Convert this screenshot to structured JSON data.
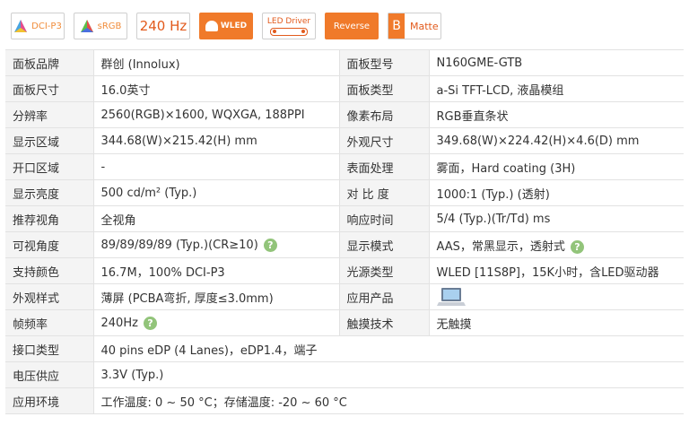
{
  "badges": {
    "dci": "DCI-P3",
    "srgb": "sRGB",
    "hz": "240 Hz",
    "wled": "WLED",
    "driver": "LED Driver",
    "reverse": "Reverse",
    "matte_letter": "B",
    "matte": "Matte"
  },
  "rows": [
    {
      "l1": "面板品牌",
      "v1": "群创 (Innolux)",
      "l2": "面板型号",
      "v2": "N160GME-GTB"
    },
    {
      "l1": "面板尺寸",
      "v1": "16.0英寸",
      "l2": "面板类型",
      "v2": "a-Si TFT-LCD, 液晶模组"
    },
    {
      "l1": "分辨率",
      "v1": "2560(RGB)×1600, WQXGA, 188PPI",
      "l2": "像素布局",
      "v2": "RGB垂直条状"
    },
    {
      "l1": "显示区域",
      "v1": "344.68(W)×215.42(H) mm",
      "l2": "外观尺寸",
      "v2": "349.68(W)×224.42(H)×4.6(D) mm"
    },
    {
      "l1": "开口区域",
      "v1": "-",
      "l2": "表面处理",
      "v2": "雾面，Hard coating (3H)"
    },
    {
      "l1": "显示亮度",
      "v1": "500 cd/m² (Typ.)",
      "l2": "对 比 度",
      "v2": "1000:1 (Typ.) (透射)"
    },
    {
      "l1": "推荐视角",
      "v1": "全视角",
      "l2": "响应时间",
      "v2": "5/4 (Typ.)(Tr/Td) ms"
    },
    {
      "l1": "可视角度",
      "v1": "89/89/89/89 (Typ.)(CR≥10)",
      "l2": "显示模式",
      "v2": "AAS，常黑显示，透射式"
    },
    {
      "l1": "支持颜色",
      "v1": "16.7M，100% DCI-P3",
      "l2": "光源类型",
      "v2": "WLED  [11S8P]，15K小时，含LED驱动器"
    },
    {
      "l1": "外观样式",
      "v1": "薄屏 (PCBA弯折, 厚度≤3.0mm)",
      "l2": "应用产品",
      "v2": ""
    },
    {
      "l1": "帧频率",
      "v1": "240Hz",
      "l2": "触摸技术",
      "v2": "无触摸"
    }
  ],
  "wide_rows": [
    {
      "label": "接口类型",
      "value": "40 pins   eDP (4 Lanes)，eDP1.4，端子"
    },
    {
      "label": "电压供应",
      "value": "3.3V (Typ.)"
    },
    {
      "label": "应用环境",
      "value": "工作温度: 0 ~ 50 °C；存储温度: -20 ~ 60 °C"
    }
  ],
  "help_glyph": "?",
  "colors": {
    "accent": "#f07a2a",
    "help": "#92c47a",
    "label_bg": "#f4f4f4",
    "link": "#2a5a8a"
  }
}
